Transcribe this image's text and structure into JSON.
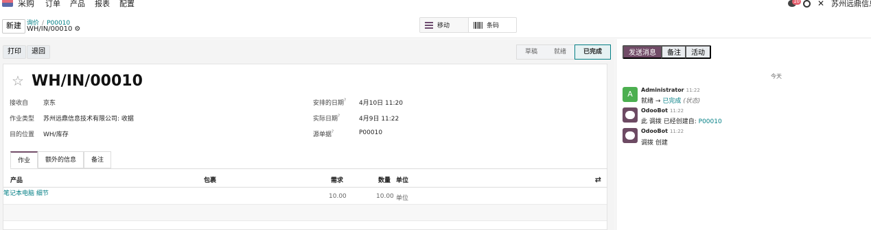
{
  "nav": {
    "app": "采购",
    "menus": [
      "订单",
      "产品",
      "报表",
      "配置"
    ],
    "badge": "10",
    "company": "苏州远鼎信息"
  },
  "control": {
    "new_label": "新建",
    "breadcrumb": [
      "询价",
      "P00010"
    ],
    "record": "WH/IN/00010",
    "views": {
      "mobile": "移动",
      "barcode": "条码"
    }
  },
  "actions": {
    "print": "打印",
    "return": "退回"
  },
  "status": {
    "stages": [
      "草稿",
      "就绪",
      "已完成"
    ],
    "active": "已完成"
  },
  "form": {
    "name": "WH/IN/00010",
    "left_fields": [
      {
        "label": "接收自",
        "value": "京东"
      },
      {
        "label": "作业类型",
        "value": "苏州远鼎信息技术有限公司: 收据"
      },
      {
        "label": "目的位置",
        "value": "WH/库存"
      }
    ],
    "right_fields": [
      {
        "label": "安排的日期",
        "help": "?",
        "value": "4月10日 11:20"
      },
      {
        "label": "实际日期",
        "help": "?",
        "value": "4月9日 11:22"
      },
      {
        "label": "源单据",
        "help": "?",
        "value": "P00010"
      }
    ],
    "tabs": [
      "作业",
      "额外的信息",
      "备注"
    ]
  },
  "table": {
    "headers": {
      "product": "产品",
      "package": "包裹",
      "demand": "需求",
      "qty": "数量",
      "uom": "单位"
    },
    "rows": [
      {
        "product": "笔记本电脑",
        "demand": "10.00",
        "qty": "10.00",
        "uom": "单位",
        "detail": "细节"
      }
    ]
  },
  "chatter": {
    "buttons": [
      "发送消息",
      "备注",
      "活动"
    ],
    "today": "今天",
    "messages": [
      {
        "author": "Administrator",
        "time": "11:22",
        "avatar": "A",
        "from": "就绪",
        "arrow": "→",
        "to": "已完成",
        "field": "(状态)"
      },
      {
        "author": "OdooBot",
        "time": "11:22",
        "text": "此 调拨 已经创建自:",
        "link": "P00010"
      },
      {
        "author": "OdooBot",
        "time": "11:22",
        "text": "调拨 创建"
      }
    ]
  },
  "colors": {
    "brand": "#714b67",
    "link": "#017e84"
  }
}
